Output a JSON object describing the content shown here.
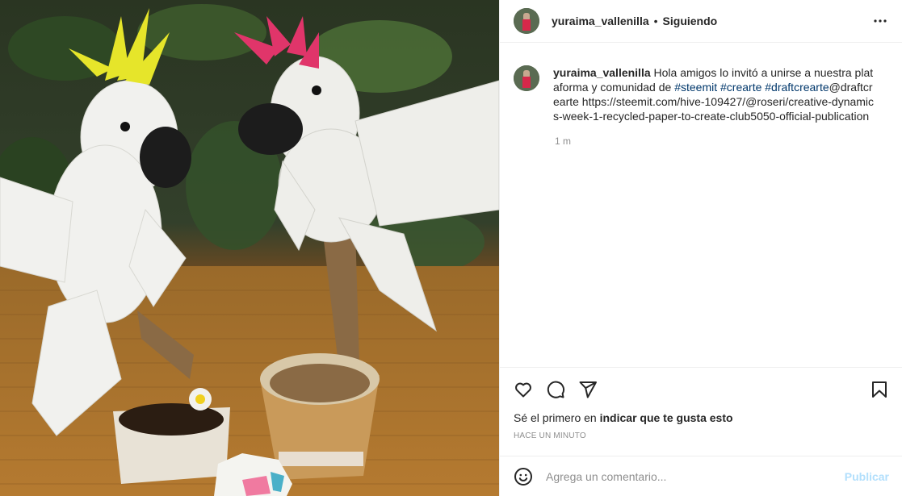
{
  "header": {
    "username": "yuraima_vallenilla",
    "separator": "•",
    "follow_label": "Siguiendo",
    "more_icon": "more-horizontal-icon"
  },
  "caption": {
    "username": "yuraima_vallenilla",
    "text_1": " Hola amigos lo invitó a unirse a nuestra plataforma y comunidad de ",
    "tag_1": "#steemit",
    "space_1": " ",
    "tag_2": "#crearte",
    "space_2": " ",
    "tag_3": "#draftcrearte",
    "text_2": "@draftcrearte https://steemit.com/hive-109427/@roseri/creative-dynamics-week-1-recycled-paper-to-create-club5050-official-publication",
    "time": "1 m"
  },
  "actions": {
    "like_icon": "heart-icon",
    "comment_icon": "comment-icon",
    "share_icon": "send-icon",
    "save_icon": "bookmark-icon"
  },
  "likes": {
    "prefix": "Sé el primero en ",
    "link": "indicar que te gusta esto"
  },
  "posted_time": "HACE UN MINUTO",
  "comment_box": {
    "placeholder": "Agrega un comentario...",
    "publish_label": "Publicar",
    "emoji_icon": "smiley-icon"
  },
  "colors": {
    "text": "#262626",
    "secondary": "#8e8e8e",
    "hashtag": "#00376b",
    "publish_disabled": "#b2dffc",
    "border": "#efefef"
  }
}
